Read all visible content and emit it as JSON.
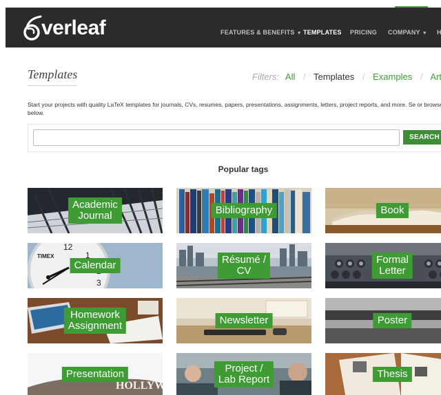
{
  "brand": {
    "logo_text": "Overleaf",
    "logo_mark": "overleaf-leaf-logo"
  },
  "nav": [
    {
      "label": "FEATURES & BENEFITS",
      "dropdown": true,
      "active": false
    },
    {
      "label": "TEMPLATES",
      "dropdown": false,
      "active": true
    },
    {
      "label": "PRICING",
      "dropdown": false,
      "active": false
    },
    {
      "label": "COMPANY",
      "dropdown": true,
      "active": false
    },
    {
      "label": "H",
      "dropdown": false,
      "active": false
    }
  ],
  "page": {
    "title": "Templates"
  },
  "filters": {
    "label": "Filters:",
    "items": [
      "All",
      "Templates",
      "Examples",
      "Artic"
    ],
    "current": "Templates"
  },
  "intro": "Start your projects with quality LaTeX templates for journals, CVs, resumes, papers, presentations, assignments, letters, project reports, and more. Se or browse below.",
  "search": {
    "placeholder": "",
    "button": "SEARCH"
  },
  "popular": {
    "heading": "Popular tags"
  },
  "tags": [
    {
      "label": "Academic\nJournal"
    },
    {
      "label": "Bibliography"
    },
    {
      "label": "Book"
    },
    {
      "label": "Calendar"
    },
    {
      "label": "Résumé /\nCV"
    },
    {
      "label": "Formal\nLetter"
    },
    {
      "label": "Homework\nAssignment"
    },
    {
      "label": "Newsletter"
    },
    {
      "label": "Poster"
    },
    {
      "label": "Presentation"
    },
    {
      "label": "Project /\nLab Report"
    },
    {
      "label": "Thesis"
    }
  ],
  "colors": {
    "accent": "#3f9c35",
    "navbar": "#2b2b2b",
    "button": "#3e8e35"
  },
  "photo_text": {
    "clock_brand": "TIMEX",
    "hollywood_sign": "HOLLYWOOD"
  }
}
